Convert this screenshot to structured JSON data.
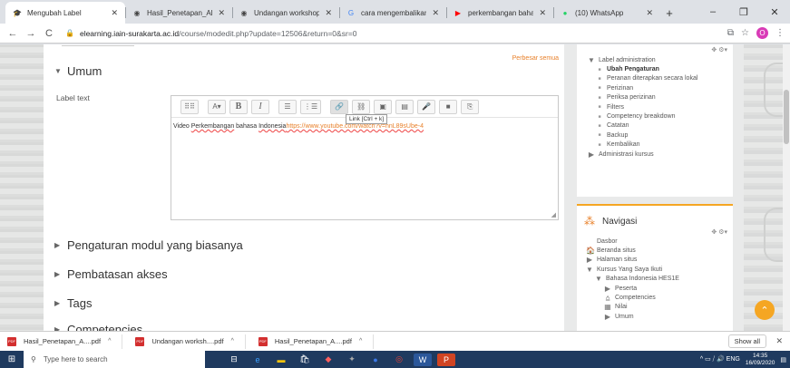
{
  "browser": {
    "tabs": [
      {
        "title": "Mengubah Label",
        "fav": "🎓",
        "fav_color": "#c8a000",
        "active": true
      },
      {
        "title": "Hasil_Penetapan_Akredi",
        "fav": "◉",
        "fav_color": "#444"
      },
      {
        "title": "Undangan workshop RI",
        "fav": "◉",
        "fav_color": "#444"
      },
      {
        "title": "cara mengembalikan ch",
        "fav": "G",
        "fav_color": "#4285f4"
      },
      {
        "title": "perkembangan bahasa",
        "fav": "▶",
        "fav_color": "#ff0000"
      },
      {
        "title": "(10) WhatsApp",
        "fav": "●",
        "fav_color": "#25d366"
      }
    ],
    "newtab": "+",
    "window_controls": [
      "–",
      "❐",
      "✕"
    ],
    "nav": {
      "back": "←",
      "forward": "→",
      "reload": "C"
    },
    "url_host": "elearning.iain-surakarta.ac.id",
    "url_path": "/course/modedit.php?update=12506&return=0&sr=0",
    "lock": "🔒",
    "right_icons": [
      "⧉",
      "☆"
    ],
    "avatar": "O",
    "menu": "⋮"
  },
  "main": {
    "expand_all": "Perbesar semua",
    "sections": [
      {
        "label": "Umum",
        "caret": "▼"
      },
      {
        "label": "Pengaturan modul yang biasanya",
        "caret": "▶"
      },
      {
        "label": "Pembatasan akses",
        "caret": "▶"
      },
      {
        "label": "Tags",
        "caret": "▶"
      },
      {
        "label": "Competencies",
        "caret": "▶"
      }
    ],
    "label_text": "Label text",
    "tooltip": "Link [Ctrl + k]",
    "content_prefix": "Video ",
    "content_underlined": "Perkembangan",
    "content_middle": " bahasa ",
    "content_u2": "Indonesia",
    "content_link": "https://www.youtube.com/watch?v=hnL89sUbe-4",
    "toolbar_icons": [
      "⠿⠿",
      "A▾",
      "B",
      "I",
      "☰",
      "⋮☰",
      "🔗",
      "⛓",
      "▣",
      "▤",
      "🎤",
      "■",
      "⎘"
    ],
    "resize": "◢"
  },
  "admin_block": {
    "settings": "✥ ⚙▾",
    "items": [
      {
        "text": "Label administration",
        "bullet": "▼",
        "level": 0
      },
      {
        "text": "Ubah Pengaturan",
        "bullet": "■",
        "level": 1,
        "bold": true
      },
      {
        "text": "Peranan diterapkan secara lokal",
        "bullet": "■",
        "level": 1
      },
      {
        "text": "Perizinan",
        "bullet": "■",
        "level": 1
      },
      {
        "text": "Periksa perizinan",
        "bullet": "■",
        "level": 1
      },
      {
        "text": "Filters",
        "bullet": "■",
        "level": 1
      },
      {
        "text": "Competency breakdown",
        "bullet": "■",
        "level": 1
      },
      {
        "text": "Catatan",
        "bullet": "■",
        "level": 1
      },
      {
        "text": "Backup",
        "bullet": "■",
        "level": 1
      },
      {
        "text": "Kembalikan",
        "bullet": "■",
        "level": 1
      },
      {
        "text": "Administrasi kursus",
        "bullet": "▶",
        "level": 0
      }
    ]
  },
  "nav_block": {
    "title": "Navigasi",
    "icon": "⁂",
    "settings": "✥ ⚙▾",
    "items": [
      {
        "text": "Dasbor",
        "bullet": "",
        "level": 0
      },
      {
        "text": "Beranda situs",
        "bullet": "🏠",
        "level": 0
      },
      {
        "text": "Halaman situs",
        "bullet": "▶",
        "level": 0
      },
      {
        "text": "Kursus Yang Saya Ikuti",
        "bullet": "▼",
        "level": 0
      },
      {
        "text": "Bahasa Indonesia HES1E",
        "bullet": "▼",
        "level": 1
      },
      {
        "text": "Peserta",
        "bullet": "▶",
        "level": 2
      },
      {
        "text": "Competencies",
        "bullet": "⩠",
        "level": 2
      },
      {
        "text": "Nilai",
        "bullet": "▦",
        "level": 2
      },
      {
        "text": "Umum",
        "bullet": "▶",
        "level": 2
      }
    ]
  },
  "scroll_top": "⌃",
  "downloads": {
    "items": [
      "Hasil_Penetapan_A....pdf",
      "Undangan worksh....pdf",
      "Hasil_Penetapan_A....pdf"
    ],
    "show_all": "Show all",
    "close": "✕"
  },
  "taskbar": {
    "start": "⊞",
    "search_placeholder": "Type here to search",
    "apps": [
      {
        "icon": "⊟",
        "color": "#ffffff",
        "bg": "transparent"
      },
      {
        "icon": "e",
        "color": "#3aa0ff",
        "bg": "transparent"
      },
      {
        "icon": "▬",
        "color": "#f4c20d",
        "bg": "transparent"
      },
      {
        "icon": "🛍",
        "color": "#ffffff",
        "bg": "transparent"
      },
      {
        "icon": "◆",
        "color": "#ff5f5f",
        "bg": "transparent"
      },
      {
        "icon": "✦",
        "color": "#aaa",
        "bg": "transparent"
      },
      {
        "icon": "●",
        "color": "#3b78e7",
        "bg": "transparent"
      },
      {
        "icon": "◎",
        "color": "#ea4335",
        "bg": "transparent"
      },
      {
        "icon": "W",
        "color": "#ffffff",
        "bg": "#2b579a"
      },
      {
        "icon": "P",
        "color": "#ffffff",
        "bg": "#d04423"
      }
    ],
    "tray": "^ ▭ ⧸ 🔊 ENG",
    "time": "14:35",
    "date": "16/09/2020",
    "notif": "▤"
  }
}
